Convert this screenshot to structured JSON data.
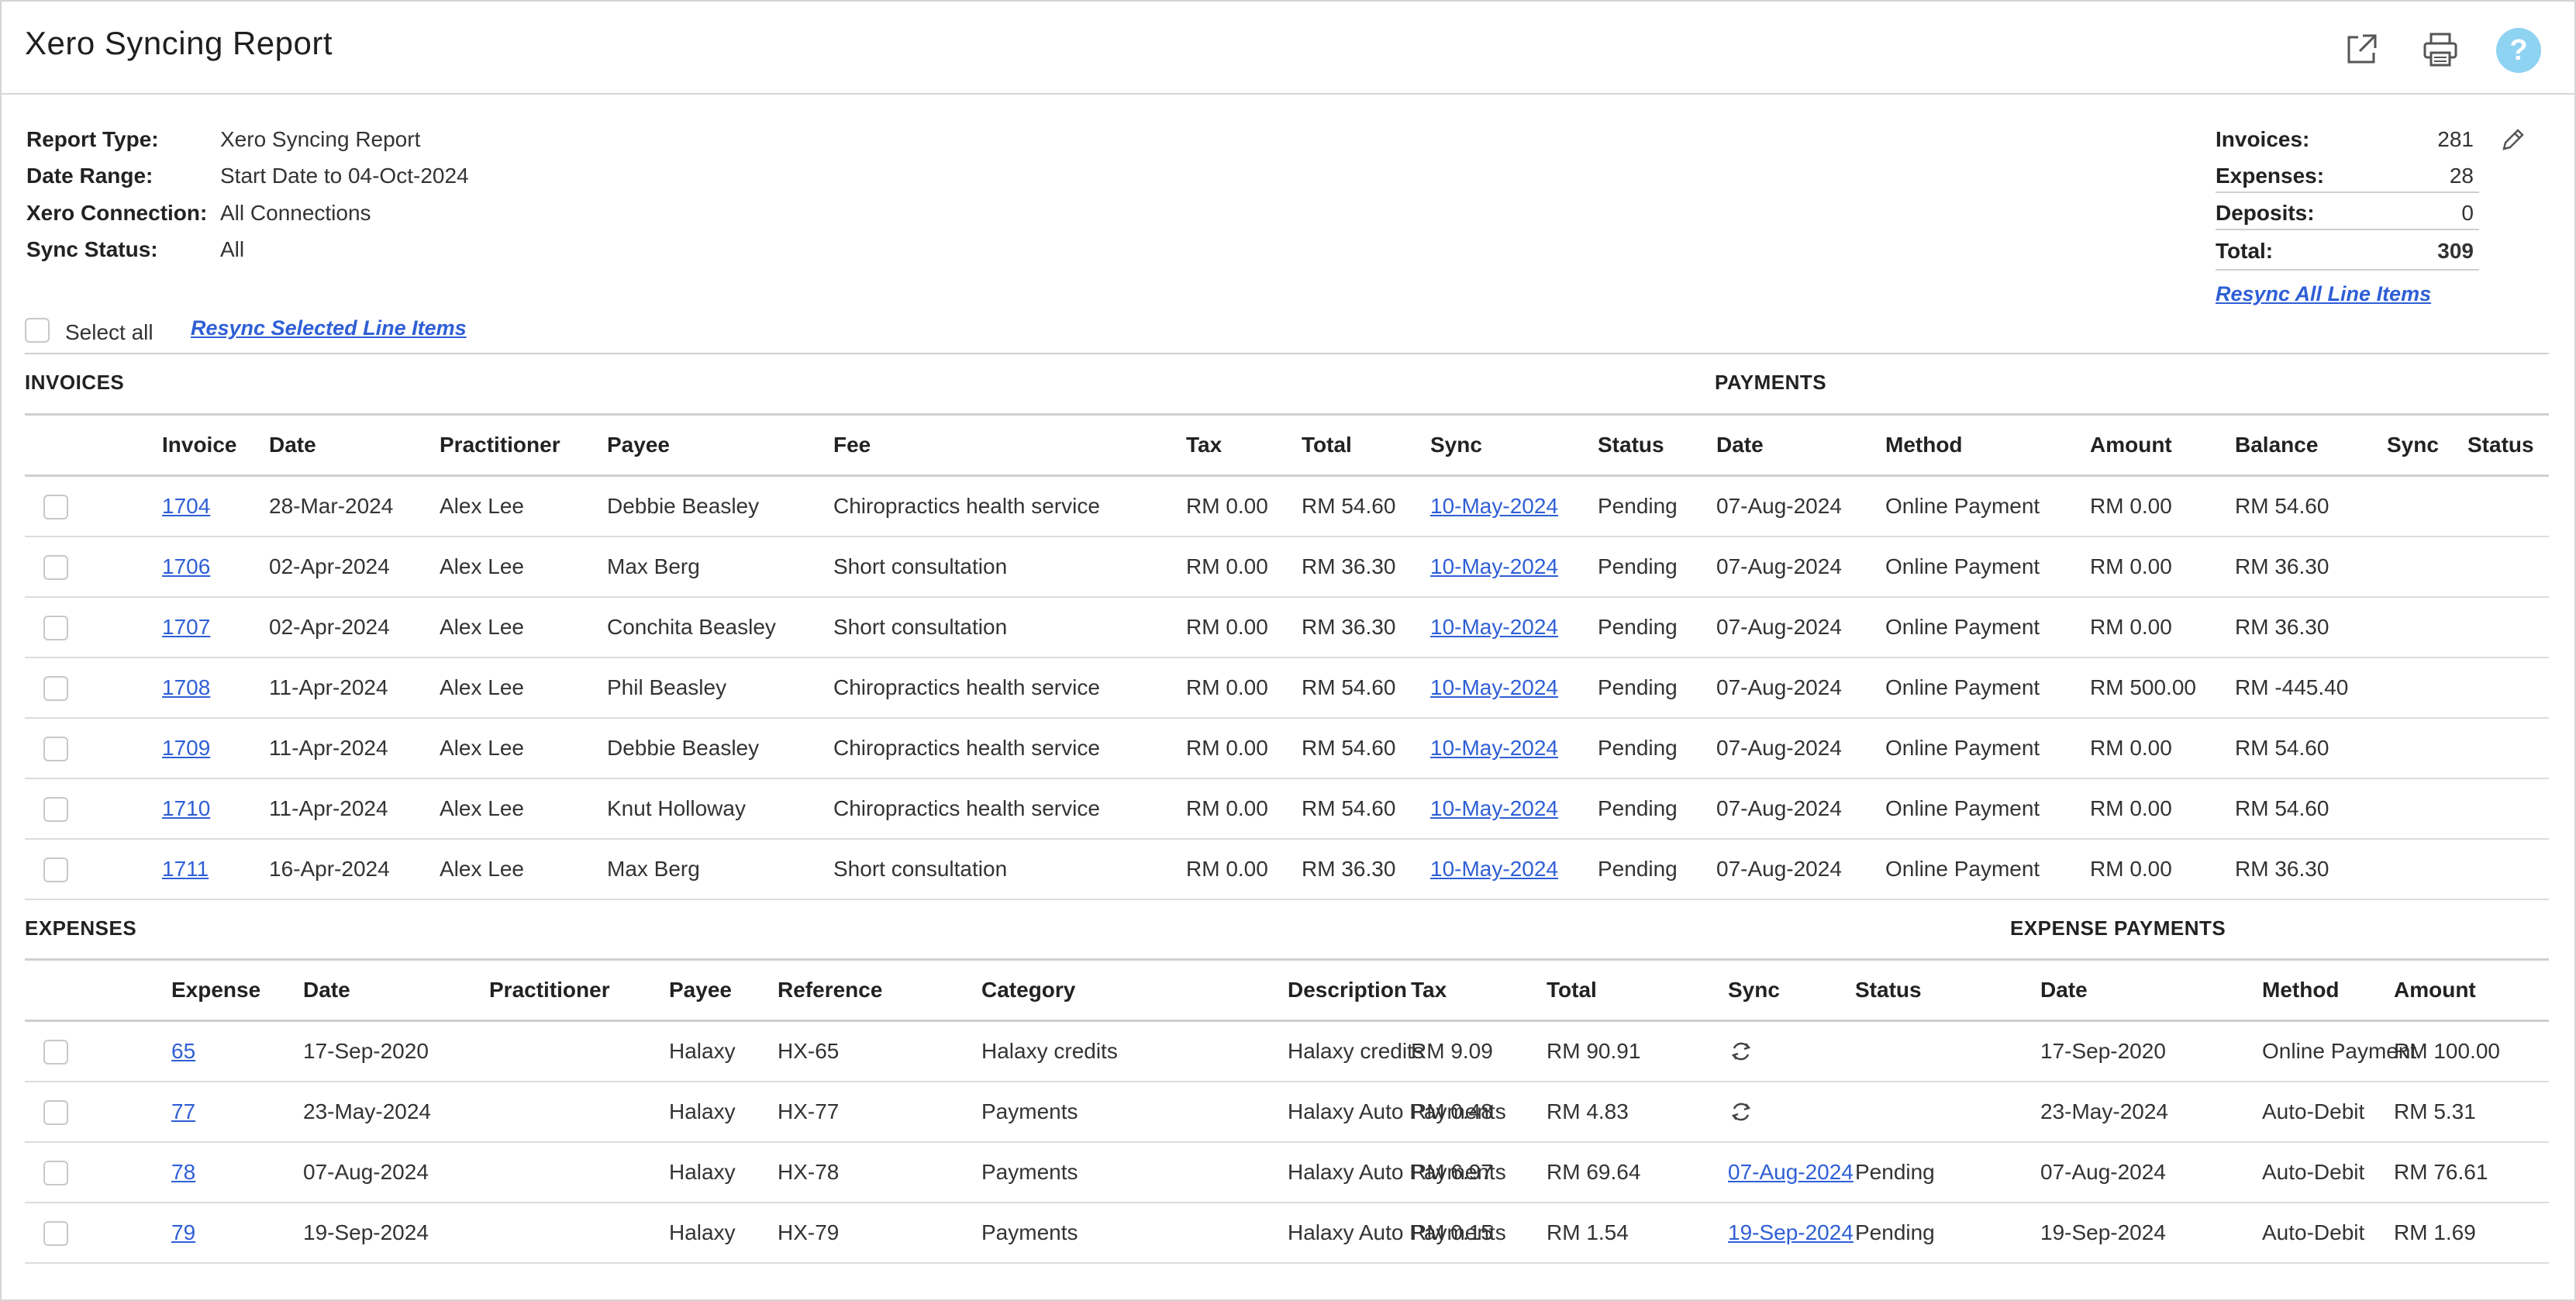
{
  "header": {
    "title": "Xero Syncing Report",
    "icons": [
      "external-link-icon",
      "printer-icon",
      "help-icon"
    ],
    "help_glyph": "?"
  },
  "meta": {
    "report_type_label": "Report Type:",
    "report_type_value": "Xero Syncing Report",
    "date_range_label": "Date Range:",
    "date_range_value": "Start Date to 04-Oct-2024",
    "connection_label": "Xero Connection:",
    "connection_value": "All Connections",
    "sync_status_label": "Sync Status:",
    "sync_status_value": "All"
  },
  "summary": {
    "invoices_label": "Invoices:",
    "invoices_value": "281",
    "expenses_label": "Expenses:",
    "expenses_value": "28",
    "deposits_label": "Deposits:",
    "deposits_value": "0",
    "total_label": "Total:",
    "total_value": "309",
    "resync_all": "Resync All Line Items"
  },
  "actions": {
    "select_all": "Select all",
    "resync_selected": "Resync Selected Line Items"
  },
  "invoices": {
    "section_title": "INVOICES",
    "payments_title": "PAYMENTS",
    "columns": [
      "",
      "Invoice",
      "Date",
      "Practitioner",
      "Payee",
      "Fee",
      "Tax",
      "Total",
      "Sync",
      "Status",
      "Date",
      "Method",
      "Amount",
      "Balance",
      "Sync",
      "Status"
    ],
    "rows": [
      {
        "invoice": "1704",
        "date": "28-Mar-2024",
        "practitioner": "Alex Lee",
        "payee": "Debbie Beasley",
        "fee": "Chiropractics health service",
        "tax": "RM 0.00",
        "total": "RM 54.60",
        "sync": "10-May-2024",
        "status": "Pending",
        "pay_date": "07-Aug-2024",
        "method": "Online Payment",
        "amount": "RM 0.00",
        "balance": "RM 54.60",
        "pay_sync": "",
        "pay_status": ""
      },
      {
        "invoice": "1706",
        "date": "02-Apr-2024",
        "practitioner": "Alex Lee",
        "payee": "Max Berg",
        "fee": "Short consultation",
        "tax": "RM 0.00",
        "total": "RM 36.30",
        "sync": "10-May-2024",
        "status": "Pending",
        "pay_date": "07-Aug-2024",
        "method": "Online Payment",
        "amount": "RM 0.00",
        "balance": "RM 36.30",
        "pay_sync": "",
        "pay_status": ""
      },
      {
        "invoice": "1707",
        "date": "02-Apr-2024",
        "practitioner": "Alex Lee",
        "payee": "Conchita Beasley",
        "fee": "Short consultation",
        "tax": "RM 0.00",
        "total": "RM 36.30",
        "sync": "10-May-2024",
        "status": "Pending",
        "pay_date": "07-Aug-2024",
        "method": "Online Payment",
        "amount": "RM 0.00",
        "balance": "RM 36.30",
        "pay_sync": "",
        "pay_status": ""
      },
      {
        "invoice": "1708",
        "date": "11-Apr-2024",
        "practitioner": "Alex Lee",
        "payee": "Phil Beasley",
        "fee": "Chiropractics health service",
        "tax": "RM 0.00",
        "total": "RM 54.60",
        "sync": "10-May-2024",
        "status": "Pending",
        "pay_date": "07-Aug-2024",
        "method": "Online Payment",
        "amount": "RM 500.00",
        "balance": "RM -445.40",
        "pay_sync": "",
        "pay_status": ""
      },
      {
        "invoice": "1709",
        "date": "11-Apr-2024",
        "practitioner": "Alex Lee",
        "payee": "Debbie Beasley",
        "fee": "Chiropractics health service",
        "tax": "RM 0.00",
        "total": "RM 54.60",
        "sync": "10-May-2024",
        "status": "Pending",
        "pay_date": "07-Aug-2024",
        "method": "Online Payment",
        "amount": "RM 0.00",
        "balance": "RM 54.60",
        "pay_sync": "",
        "pay_status": ""
      },
      {
        "invoice": "1710",
        "date": "11-Apr-2024",
        "practitioner": "Alex Lee",
        "payee": "Knut Holloway",
        "fee": "Chiropractics health service",
        "tax": "RM 0.00",
        "total": "RM 54.60",
        "sync": "10-May-2024",
        "status": "Pending",
        "pay_date": "07-Aug-2024",
        "method": "Online Payment",
        "amount": "RM 0.00",
        "balance": "RM 54.60",
        "pay_sync": "",
        "pay_status": ""
      },
      {
        "invoice": "1711",
        "date": "16-Apr-2024",
        "practitioner": "Alex Lee",
        "payee": "Max Berg",
        "fee": "Short consultation",
        "tax": "RM 0.00",
        "total": "RM 36.30",
        "sync": "10-May-2024",
        "status": "Pending",
        "pay_date": "07-Aug-2024",
        "method": "Online Payment",
        "amount": "RM 0.00",
        "balance": "RM 36.30",
        "pay_sync": "",
        "pay_status": ""
      }
    ]
  },
  "expenses": {
    "section_title": "EXPENSES",
    "payments_title": "EXPENSE PAYMENTS",
    "columns": [
      "",
      "Expense",
      "Date",
      "Practitioner",
      "Payee",
      "Reference",
      "Category",
      "Description",
      "Tax",
      "Total",
      "Sync",
      "Status",
      "Date",
      "Method",
      "Amount"
    ],
    "rows": [
      {
        "expense": "65",
        "date": "17-Sep-2020",
        "practitioner": "",
        "payee": "Halaxy",
        "reference": "HX-65",
        "category": "Halaxy credits",
        "description": "Halaxy credits",
        "tax": "RM 9.09",
        "total": "RM 90.91",
        "sync": "",
        "sync_icon": "refresh-icon",
        "status": "",
        "pay_date": "17-Sep-2020",
        "method": "Online Payment",
        "amount": "RM 100.00"
      },
      {
        "expense": "77",
        "date": "23-May-2024",
        "practitioner": "",
        "payee": "Halaxy",
        "reference": "HX-77",
        "category": "Payments",
        "description": "Halaxy Auto Payments",
        "tax": "RM 0.48",
        "total": "RM 4.83",
        "sync": "",
        "sync_icon": "refresh-icon",
        "status": "",
        "pay_date": "23-May-2024",
        "method": "Auto-Debit",
        "amount": "RM 5.31"
      },
      {
        "expense": "78",
        "date": "07-Aug-2024",
        "practitioner": "",
        "payee": "Halaxy",
        "reference": "HX-78",
        "category": "Payments",
        "description": "Halaxy Auto Payments",
        "tax": "RM 6.97",
        "total": "RM 69.64",
        "sync": "07-Aug-2024",
        "sync_icon": "",
        "status": "Pending",
        "pay_date": "07-Aug-2024",
        "method": "Auto-Debit",
        "amount": "RM 76.61"
      },
      {
        "expense": "79",
        "date": "19-Sep-2024",
        "practitioner": "",
        "payee": "Halaxy",
        "reference": "HX-79",
        "category": "Payments",
        "description": "Halaxy Auto Payments",
        "tax": "RM 0.15",
        "total": "RM 1.54",
        "sync": "19-Sep-2024",
        "sync_icon": "",
        "status": "Pending",
        "pay_date": "19-Sep-2024",
        "method": "Auto-Debit",
        "amount": "RM 1.69"
      }
    ]
  },
  "colors": {
    "link": "#2f5fd6",
    "help_circle": "#8fd3f2",
    "border": "#d0d0d0"
  }
}
